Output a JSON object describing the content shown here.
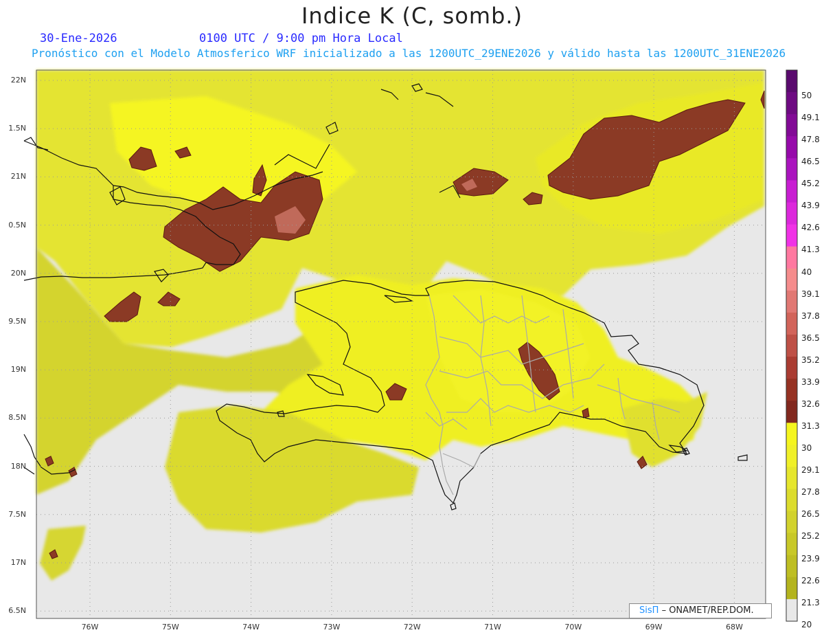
{
  "header": {
    "title": "Indice K (C, somb.)",
    "date": "30-Ene-2026",
    "time": "0100 UTC / 9:00 pm Hora Local",
    "subtitle": "Pronóstico con el Modelo Atmosferico WRF inicializado a las 1200UTC_29ENE2026 y válido hasta las  1200UTC_31ENE2026"
  },
  "map": {
    "lat_labels": [
      "22N",
      "1.5N",
      "21N",
      "0.5N",
      "20N",
      "9.5N",
      "19N",
      "8.5N",
      "18N",
      "7.5N",
      "17N",
      "6.5N"
    ],
    "lon_labels": [
      "76W",
      "75W",
      "74W",
      "73W",
      "72W",
      "71W",
      "70W",
      "69W",
      "68W"
    ],
    "land_outline_color": "#111111",
    "provinces_color": "#aaaaaa",
    "background_color": "#e8e8e8"
  },
  "colorbar": {
    "labels": [
      "50",
      "49.1",
      "47.8",
      "46.5",
      "45.2",
      "43.9",
      "42.6",
      "41.3",
      "40",
      "39.1",
      "37.8",
      "36.5",
      "35.2",
      "33.9",
      "32.6",
      "31.3",
      "30",
      "29.1",
      "27.8",
      "26.5",
      "25.2",
      "23.9",
      "22.6",
      "21.3",
      "20"
    ],
    "colors": [
      "#5a0a6e",
      "#6e0a82",
      "#820a96",
      "#960aaa",
      "#aa14be",
      "#c81ed2",
      "#dc28dc",
      "#f032e6",
      "#ff78a0",
      "#f58c8c",
      "#e17873",
      "#d2645a",
      "#be5046",
      "#aa3c32",
      "#963223",
      "#82281e",
      "#f5f51e",
      "#f0f028",
      "#e6e62d",
      "#dcdc2d",
      "#d2d22d",
      "#c8c828",
      "#bebe23",
      "#b4b41e"
    ]
  },
  "credit": {
    "brand": "SisΠ",
    "text": "– ONAMET/REP.DOM."
  }
}
